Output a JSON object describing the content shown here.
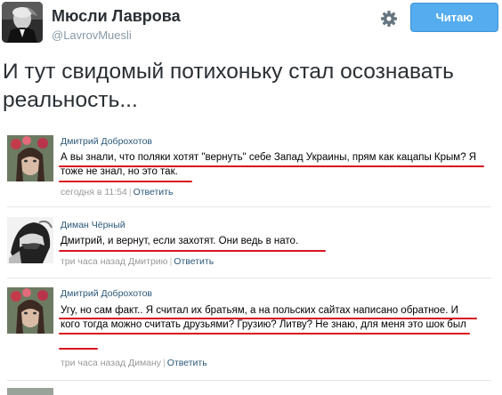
{
  "tweet": {
    "author_name": "Мюсли Лаврова",
    "author_handle": "@LavrovMuesli",
    "follow_label": "Читаю",
    "text": "И тут свидомый потихоньку стал осознавать реальность..."
  },
  "icons": {
    "settings": "gear-icon"
  },
  "colors": {
    "follow_bg": "#55acee",
    "link": "#2b587a",
    "underline": "#d8141f"
  },
  "comments": [
    {
      "author": "Дмитрий Доброхотов",
      "text": "А вы знали, что поляки хотят \"вернуть\" себе Запад Украины, прям как кацапы Крым? Я тоже не знал, но это так.",
      "time": "сегодня в 11:54",
      "reply": "Ответить"
    },
    {
      "author": "Диман Чёрный",
      "text": "Дмитрий, и вернут, если захотят. Они ведь в нато.",
      "time": "три часа назад Дмитрию",
      "reply": "Ответить"
    },
    {
      "author": "Дмитрий Доброхотов",
      "text": "Угу, но сам факт.. Я считал их братьям, а на польских сайтах написано обратное. И кого тогда можно считать друзьями? Грузию? Литву? Не знаю, для меня это шок был",
      "time": "три часа назад Диману",
      "reply": "Ответить"
    }
  ]
}
